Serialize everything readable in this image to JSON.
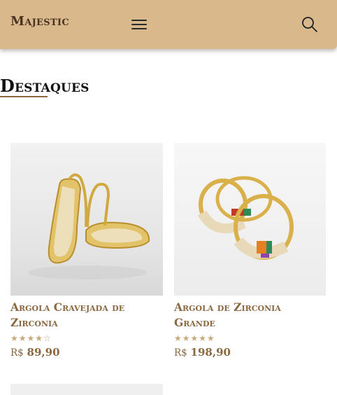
{
  "header": {
    "brand": "Majestic"
  },
  "section": {
    "title": "Destaques"
  },
  "products": [
    {
      "name": "Argola Cravejada de Zirconia",
      "rating_stars": 4,
      "rating_max": 5,
      "currency": "R$",
      "price": "89,90",
      "image": "gold-hoop-earrings-cravejada"
    },
    {
      "name": "Argola de Zirconia Grande",
      "rating_stars": 5,
      "rating_max": 5,
      "currency": "R$",
      "price": "198,90",
      "image": "gold-hoop-earrings-colored-stones"
    }
  ],
  "colors": {
    "header_bg": "#d9b88c",
    "accent": "#8a6840",
    "brand_text": "#4a3320",
    "star": "#c9a97a"
  },
  "icons": {
    "menu": "hamburger-menu-icon",
    "search": "search-icon"
  }
}
